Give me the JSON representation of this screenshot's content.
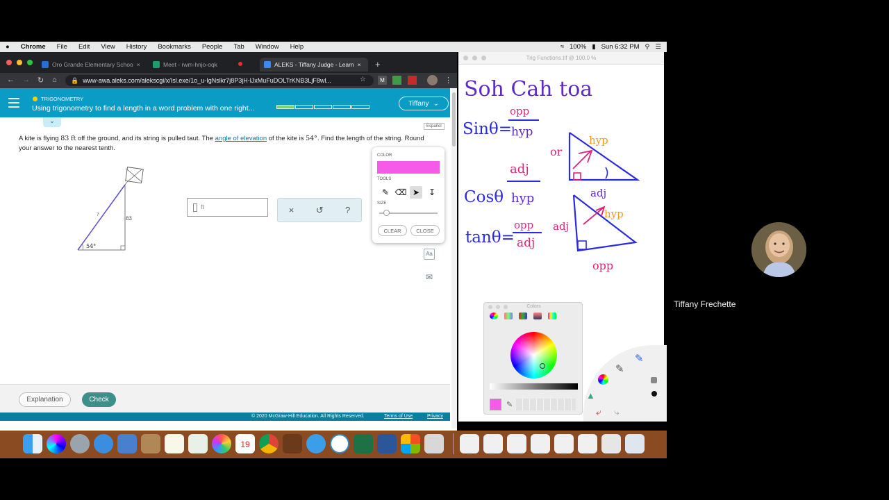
{
  "menubar": {
    "apple": "",
    "items": [
      "Chrome",
      "File",
      "Edit",
      "View",
      "History",
      "Bookmarks",
      "People",
      "Tab",
      "Window",
      "Help"
    ],
    "battery": "100%",
    "clock": "Sun 6:32 PM"
  },
  "browser": {
    "tabs": [
      {
        "label": "Oro Grande Elementary Schoo",
        "favicon": "calendar-icon",
        "color": "#2b6bd6"
      },
      {
        "label": "Meet - rwm-hnjo-oqk",
        "favicon": "meet-icon",
        "color": "#1a9e6b"
      },
      {
        "label": "ALEKS - Tiffany Judge - Learn",
        "favicon": "aleks-icon",
        "color": "#4285f4"
      }
    ],
    "url": "www-awa.aleks.com/alekscgi/x/Isl.exe/1o_u-IgNslkr7j8P3jH-lJxMuFuDOLTrKNB3LjF8wl..."
  },
  "aleks": {
    "topic": "TRIGONOMETRY",
    "title": "Using trigonometry to find a length in a word problem with one right...",
    "progress_filled": 1,
    "progress_total": 5,
    "user": "Tiffany",
    "espanol": "Español",
    "question_part1": "A kite is flying ",
    "height": "83",
    "unit": "ft",
    "question_part2": " off the ground, and its string is pulled taut. The ",
    "link": "angle of elevation",
    "question_part3": " of the kite is ",
    "angle": "54°",
    "question_part4": ". Find the length of the string. Round your answer to the nearest tenth.",
    "figure": {
      "angle_label": "54°",
      "side_label": "83",
      "hyp_label": "?"
    },
    "answer_unit": "ft",
    "keypad": [
      "×",
      "↺",
      "?"
    ],
    "draw_panel": {
      "color_label": "COLOR",
      "tools_label": "TOOLS",
      "size_label": "SIZE",
      "clear": "CLEAR",
      "close": "CLOSE",
      "color": "#f55be8",
      "size": 0.12
    },
    "explanation": "Explanation",
    "check": "Check",
    "copyright": "© 2020 McGraw-Hill Education. All Rights Reserved.",
    "terms": "Terms of Use",
    "privacy": "Privacy"
  },
  "preview": {
    "title": "Trig Functions.tif @ 100.0 %",
    "notes": {
      "heading": "Soh Cah toa",
      "sin": "Sinθ=",
      "sin_num": "opp",
      "sin_den": "hyp",
      "cos": "Cosθ",
      "cos_num": "adj",
      "cos_den": "hyp",
      "tan": "tanθ=",
      "tan_num": "opp",
      "tan_den": "adj",
      "or1": "or",
      "hyp1": "hyp",
      "adj1": "adj",
      "adj2": "adj",
      "hyp2": "hyp",
      "opp2": "opp"
    }
  },
  "colors_panel": {
    "title": "Colors",
    "selected": "#f55be8"
  },
  "participant": {
    "name": "Tiffany Frechette"
  }
}
